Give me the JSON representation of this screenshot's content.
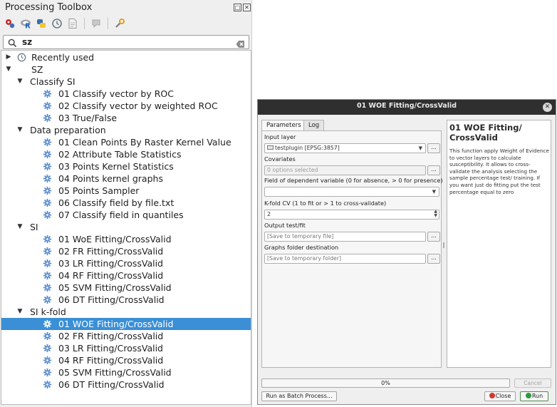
{
  "toolbox": {
    "title": "Processing Toolbox",
    "search_value": "sz",
    "tree": [
      {
        "label": "Recently used",
        "level": 0,
        "kind": "recent",
        "expanded": false
      },
      {
        "label": "SZ",
        "level": 0,
        "kind": "group",
        "expanded": true
      },
      {
        "label": "Classify SI",
        "level": 1,
        "kind": "group",
        "expanded": true
      },
      {
        "label": "01 Classify vector by ROC",
        "level": 2,
        "kind": "alg"
      },
      {
        "label": "02 Classify vector by weighted ROC",
        "level": 2,
        "kind": "alg"
      },
      {
        "label": "03 True/False",
        "level": 2,
        "kind": "alg"
      },
      {
        "label": "Data preparation",
        "level": 1,
        "kind": "group",
        "expanded": true
      },
      {
        "label": "01 Clean Points By Raster Kernel Value",
        "level": 2,
        "kind": "alg"
      },
      {
        "label": "02 Attribute Table Statistics",
        "level": 2,
        "kind": "alg"
      },
      {
        "label": "03 Points Kernel Statistics",
        "level": 2,
        "kind": "alg"
      },
      {
        "label": "04 Points kernel graphs",
        "level": 2,
        "kind": "alg"
      },
      {
        "label": "05 Points Sampler",
        "level": 2,
        "kind": "alg"
      },
      {
        "label": "06 Classify field by file.txt",
        "level": 2,
        "kind": "alg"
      },
      {
        "label": "07 Classify field in quantiles",
        "level": 2,
        "kind": "alg"
      },
      {
        "label": "SI",
        "level": 1,
        "kind": "group",
        "expanded": true
      },
      {
        "label": "01 WoE Fitting/CrossValid",
        "level": 2,
        "kind": "alg"
      },
      {
        "label": "02 FR Fitting/CrossValid",
        "level": 2,
        "kind": "alg"
      },
      {
        "label": "03 LR Fitting/CrossValid",
        "level": 2,
        "kind": "alg"
      },
      {
        "label": "04 RF Fitting/CrossValid",
        "level": 2,
        "kind": "alg"
      },
      {
        "label": "05 SVM Fitting/CrossValid",
        "level": 2,
        "kind": "alg"
      },
      {
        "label": "06 DT Fitting/CrossValid",
        "level": 2,
        "kind": "alg"
      },
      {
        "label": "SI k-fold",
        "level": 1,
        "kind": "group",
        "expanded": true
      },
      {
        "label": "01 WOE Fitting/CrossValid",
        "level": 2,
        "kind": "alg",
        "selected": true
      },
      {
        "label": "02 FR Fitting/CrossValid",
        "level": 2,
        "kind": "alg"
      },
      {
        "label": "03 LR Fitting/CrossValid",
        "level": 2,
        "kind": "alg"
      },
      {
        "label": "04 RF Fitting/CrossValid",
        "level": 2,
        "kind": "alg"
      },
      {
        "label": "05 SVM Fitting/CrossValid",
        "level": 2,
        "kind": "alg"
      },
      {
        "label": "06 DT Fitting/CrossValid",
        "level": 2,
        "kind": "alg"
      }
    ],
    "toolbar_icons": [
      "models-icon",
      "r-scripts-icon",
      "python-scripts-icon",
      "history-icon",
      "results-viewer-icon",
      "edit-features-in-place-icon",
      "options-icon"
    ]
  },
  "dialog": {
    "title": "01 WOE Fitting/CrossValid",
    "tabs": [
      "Parameters",
      "Log"
    ],
    "fields": {
      "input_layer_label": "Input layer",
      "input_layer_value": "testplugin [EPSG:3857]",
      "covariates_label": "Covariates",
      "covariates_value": "0 options selected",
      "dependent_label": "Field of dependent variable (0 for absence, > 0 for presence)",
      "dependent_value": "",
      "kfold_label": "K-fold CV (1 to fit or > 1 to cross-validate)",
      "kfold_value": "2",
      "output_label": "Output test/fit",
      "output_placeholder": "[Save to temporary file]",
      "graphs_label": "Graphs folder destination",
      "graphs_placeholder": "[Save to temporary folder]",
      "browse_label": "..."
    },
    "help": {
      "title": "01 WOE Fitting/ CrossValid",
      "text": "This function apply Weight of Evidence to vector layers to calculate susceptibility. It allows to cross-validate the analysis selecting the sample percentage test/ training. If you want just do fitting put the test percentage equal to zero"
    },
    "progress": {
      "value": 0,
      "label": "0%"
    },
    "buttons": {
      "cancel": "Cancel",
      "batch": "Run as Batch Process...",
      "close": "Close",
      "run": "Run"
    },
    "colors": {
      "titlebar": "#2f2f2f",
      "selection": "#3a8fd6",
      "run_icon": "#2e9a3c",
      "close_icon": "#d03a2f"
    }
  }
}
